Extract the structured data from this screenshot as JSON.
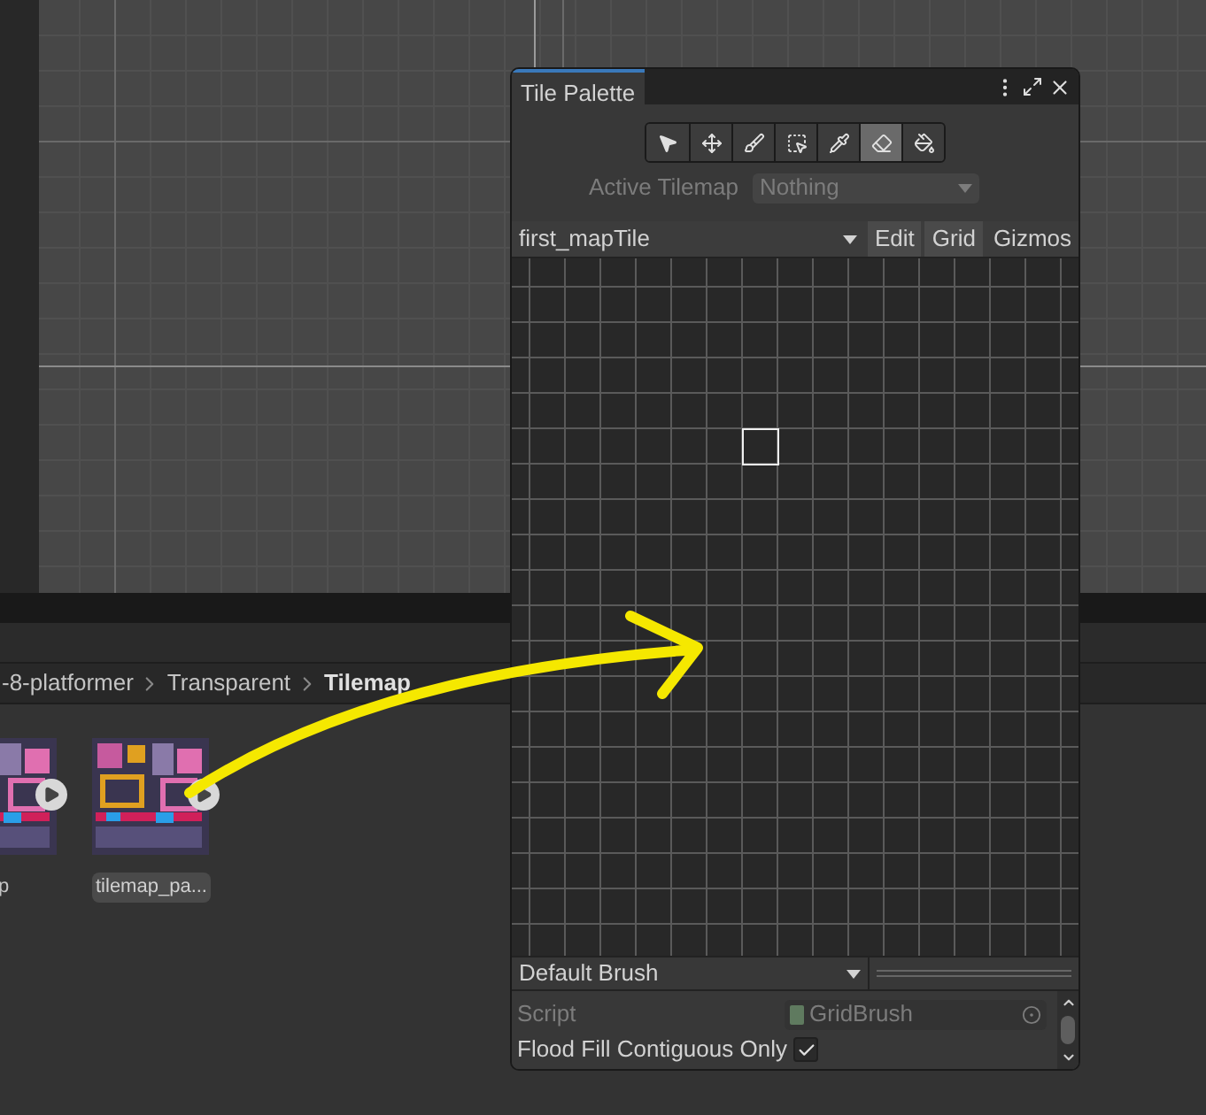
{
  "project": {
    "breadcrumb": [
      {
        "label": "-8-platformer",
        "current": false
      },
      {
        "label": "Transparent",
        "current": false
      },
      {
        "label": "Tilemap",
        "current": true
      }
    ],
    "assets": [
      {
        "label": "p"
      },
      {
        "label": "tilemap_pa..."
      }
    ]
  },
  "tile_palette": {
    "title": "Tile Palette",
    "tools": [
      {
        "selected": false
      },
      {
        "selected": false
      },
      {
        "selected": false
      },
      {
        "selected": false
      },
      {
        "selected": false
      },
      {
        "selected": true
      },
      {
        "selected": false
      }
    ],
    "active_tilemap": {
      "label": "Active Tilemap",
      "value": "Nothing",
      "disabled": true
    },
    "palette": {
      "value": "first_mapTile"
    },
    "buttons": [
      {
        "label": "Edit",
        "on": true
      },
      {
        "label": "Grid",
        "on": true
      },
      {
        "label": "Gizmos",
        "on": false
      }
    ],
    "brush": {
      "value": "Default Brush"
    },
    "fields": [
      {
        "kind": "object",
        "label": "Script",
        "value": "GridBrush",
        "disabled": true
      },
      {
        "kind": "checkbox",
        "label": "Flood Fill Contiguous Only",
        "checked": true
      }
    ]
  }
}
